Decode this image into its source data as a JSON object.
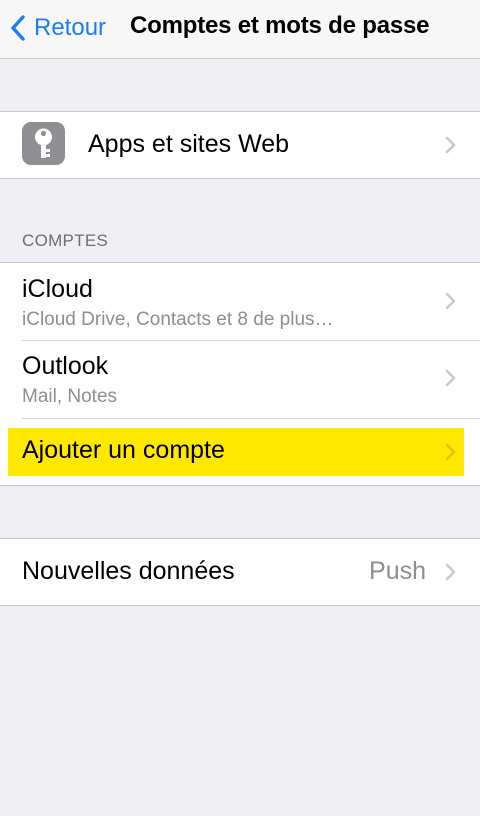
{
  "navbar": {
    "back_label": "Retour",
    "title": "Comptes et mots de passe"
  },
  "passwords": {
    "icon": "key-icon",
    "label": "Apps et sites Web"
  },
  "accounts": {
    "header": "COMPTES",
    "items": [
      {
        "label": "iCloud",
        "subtitle": "iCloud Drive, Contacts et 8 de plus…"
      },
      {
        "label": "Outlook",
        "subtitle": "Mail, Notes"
      }
    ],
    "add_label": "Ajouter un compte",
    "highlight_color": "#ffe800"
  },
  "fetch": {
    "label": "Nouvelles données",
    "value": "Push"
  },
  "colors": {
    "accent": "#1a7dfb",
    "background": "#efeff4",
    "secondary_text": "#8e8e93"
  }
}
